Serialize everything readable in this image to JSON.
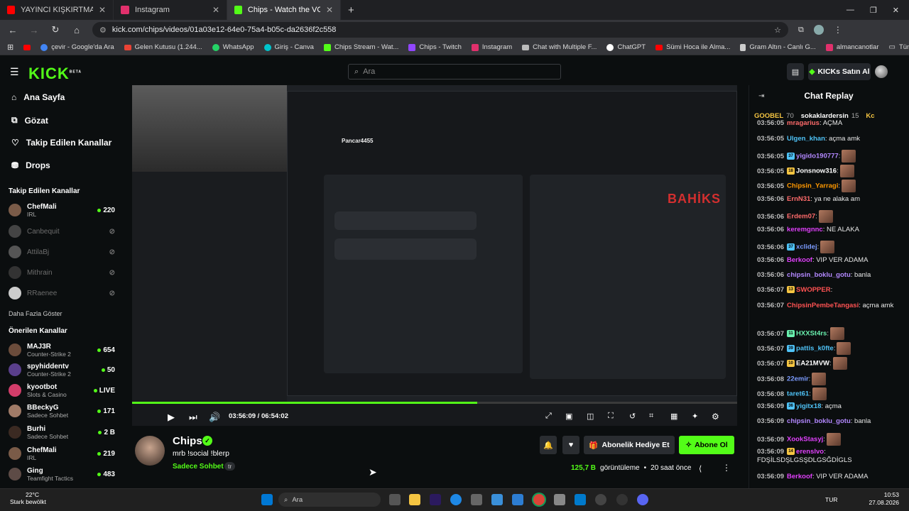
{
  "browser": {
    "tabs": [
      {
        "label": "YAYINCI KIŞKIRTMA : EVE DÖNÜ",
        "active": false,
        "favicon_color": "#ff0000"
      },
      {
        "label": "Instagram",
        "active": false,
        "favicon_color": "#e1306c"
      },
      {
        "label": "Chips - Watch the VOD on Kick",
        "active": true,
        "favicon_color": "#53fc18"
      }
    ],
    "new_tab": "+",
    "url": "kick.com/chips/videos/01a03e12-64e0-75a4-b05c-da2636f2c558",
    "bookmarks": [
      "çevir - Google'da Ara",
      "Gelen Kutusu (1.244...",
      "WhatsApp",
      "Giriş - Canva",
      "Chips Stream - Wat...",
      "Chips - Twitch",
      "Instagram",
      "Chat with Multiple F...",
      "ChatGPT",
      "Sümi Hoca ile Alma...",
      "Gram Altın - Canlı G...",
      "almancanotlar"
    ],
    "all_bookmarks": "Tüm Yer İşaretleri"
  },
  "header": {
    "logo": "KICK",
    "logo_sup": "BETA",
    "search_placeholder": "Ara",
    "kicks_button": "KICKs Satın Al"
  },
  "sidebar": {
    "nav": [
      {
        "label": "Ana Sayfa",
        "icon": "home-icon"
      },
      {
        "label": "Gözat",
        "icon": "browse-icon"
      },
      {
        "label": "Takip Edilen Kanallar",
        "icon": "heart-icon"
      },
      {
        "label": "Drops",
        "icon": "drops-icon"
      }
    ],
    "following_title": "Takip Edilen Kanallar",
    "following": [
      {
        "name": "ChefMali",
        "category": "IRL",
        "viewers": "220",
        "live": true,
        "color": "#7a5b48"
      },
      {
        "name": "Canbequit",
        "category": "",
        "viewers": "",
        "live": false,
        "color": "#444"
      },
      {
        "name": "AttilaBj",
        "category": "",
        "viewers": "",
        "live": false,
        "color": "#555"
      },
      {
        "name": "Mithrain",
        "category": "",
        "viewers": "",
        "live": false,
        "color": "#333"
      },
      {
        "name": "RRaenee",
        "category": "",
        "viewers": "",
        "live": false,
        "color": "#ccc"
      }
    ],
    "show_more": "Daha Fazla Göster",
    "recommended_title": "Önerilen Kanallar",
    "recommended": [
      {
        "name": "MAJ3R",
        "category": "Counter-Strike 2",
        "viewers": "654",
        "color": "#6b4c3b"
      },
      {
        "name": "spyhiddentv",
        "category": "Counter-Strike 2",
        "viewers": "50",
        "color": "#5a3f8c"
      },
      {
        "name": "kyootbot",
        "category": "Slots & Casino",
        "viewers": "LIVE",
        "color": "#d23d6a"
      },
      {
        "name": "BBeckyG",
        "category": "Sadece Sohbet",
        "viewers": "171",
        "color": "#a07b67"
      },
      {
        "name": "Burhi",
        "category": "Sadece Sohbet",
        "viewers": "2 B",
        "color": "#3b2a22"
      },
      {
        "name": "ChefMali",
        "category": "IRL",
        "viewers": "219",
        "color": "#7a5b48"
      },
      {
        "name": "Ging",
        "category": "Teamfight Tactics",
        "viewers": "483",
        "color": "#5d4b46"
      }
    ]
  },
  "video": {
    "time_current": "03:56:09",
    "time_total": "06:54:02",
    "progress": 0.571,
    "overlay_brand": "BAHİKS",
    "overlay_user": "Pancar4455"
  },
  "channel": {
    "name": "Chips",
    "title": "mrb !social !blerp",
    "category": "Sadece Sohbet",
    "language": "tr",
    "gift_button": "Abonelik Hediye Et",
    "subscribe_button": "Abone Ol",
    "views": "125,7 B",
    "views_label": "görüntüleme",
    "sep": "•",
    "age": "20 saat önce"
  },
  "chat": {
    "title": "Chat Replay",
    "pinned": [
      {
        "name": "GOOBEL",
        "count": "70",
        "color": "#f5c542"
      },
      {
        "name": "sokaklardersin",
        "count": "15",
        "color": "#ffffff"
      },
      {
        "name": "Kc",
        "count": "",
        "color": "#f5c542"
      }
    ],
    "messages": [
      {
        "time": "03:56:05",
        "user": "mragarius",
        "color": "#ff6b6b",
        "text": ": AÇMA",
        "badge": "",
        "emote": false
      },
      {
        "time": "03:56:05",
        "user": "Ulgen_khan",
        "color": "#4fc3f7",
        "text": ": açma amk",
        "badge": "",
        "emote": false
      },
      {
        "time": "03:56:05",
        "user": "yigido190777",
        "color": "#b388ff",
        "text": ":",
        "badge": "37",
        "emote": true
      },
      {
        "time": "03:56:05",
        "user": "Jonsnow316",
        "color": "#ffffff",
        "text": ":",
        "badge": "18",
        "emote": true
      },
      {
        "time": "03:56:05",
        "user": "Chipsin_Yarragi",
        "color": "#ff9800",
        "text": ":",
        "badge": "",
        "emote": true
      },
      {
        "time": "03:56:06",
        "user": "ErnN31",
        "color": "#ff6b6b",
        "text": ": ya ne alaka am",
        "badge": "",
        "emote": false
      },
      {
        "time": "03:56:06",
        "user": "Erdem07",
        "color": "#ff6b6b",
        "text": ":",
        "badge": "",
        "emote": true
      },
      {
        "time": "03:56:06",
        "user": "keremgnnc",
        "color": "#e040fb",
        "text": ": NE ALAKA",
        "badge": "",
        "emote": false
      },
      {
        "time": "03:56:06",
        "user": "xclidej",
        "color": "#7c9cff",
        "text": ":",
        "badge": "37",
        "emote": true
      },
      {
        "time": "03:56:06",
        "user": "Berkoof",
        "color": "#e040fb",
        "text": ": VIP VER ADAMA",
        "badge": "",
        "emote": false
      },
      {
        "time": "03:56:06",
        "user": "chipsin_boklu_gotu",
        "color": "#b388ff",
        "text": ": banla",
        "badge": "",
        "emote": false
      },
      {
        "time": "03:56:07",
        "user": "SWOPPER",
        "color": "#ff5252",
        "text": ":",
        "badge": "13",
        "emote": false
      },
      {
        "time": "03:56:07",
        "user": "ChipsinPembeTangasi",
        "color": "#ff5252",
        "text": ": açma amk",
        "badge": "",
        "emote": false
      },
      {
        "time": "03:56:07",
        "user": "HXXSt4rs",
        "color": "#69f0ae",
        "text": ":",
        "badge": "11",
        "emote": true
      },
      {
        "time": "03:56:07",
        "user": "pattis_k0fte",
        "color": "#4fc3f7",
        "text": ":",
        "badge": "39",
        "emote": true
      },
      {
        "time": "03:56:07",
        "user": "EA21MVW",
        "color": "#ffffff",
        "text": ":",
        "badge": "10",
        "emote": true
      },
      {
        "time": "03:56:08",
        "user": "22emir",
        "color": "#7c9cff",
        "text": ":",
        "badge": "",
        "emote": true
      },
      {
        "time": "03:56:08",
        "user": "taret61",
        "color": "#4fc3f7",
        "text": ":",
        "badge": "",
        "emote": true
      },
      {
        "time": "03:56:09",
        "user": "yigitx18",
        "color": "#4fc3f7",
        "text": ": açma",
        "badge": "36",
        "emote": false
      },
      {
        "time": "03:56:09",
        "user": "chipsin_boklu_gotu",
        "color": "#b388ff",
        "text": ": banla",
        "badge": "",
        "emote": false
      },
      {
        "time": "03:56:09",
        "user": "XookStasyj",
        "color": "#e040fb",
        "text": ":",
        "badge": "",
        "emote": true
      },
      {
        "time": "03:56:09",
        "user": "erenslvo",
        "color": "#e040fb",
        "text": ": FDŞİLSDŞLGSŞDLGSĞDİGLS",
        "badge": "14",
        "emote": false
      },
      {
        "time": "03:56:09",
        "user": "Berkoof",
        "color": "#e040fb",
        "text": ": VIP VER ADAMA",
        "badge": "",
        "emote": false
      }
    ]
  },
  "taskbar": {
    "temperature": "22°C",
    "weather": "Stark bewölkt",
    "search": "Ara",
    "lang": "TUR",
    "time": "10:53",
    "date": "27.08.2026"
  }
}
